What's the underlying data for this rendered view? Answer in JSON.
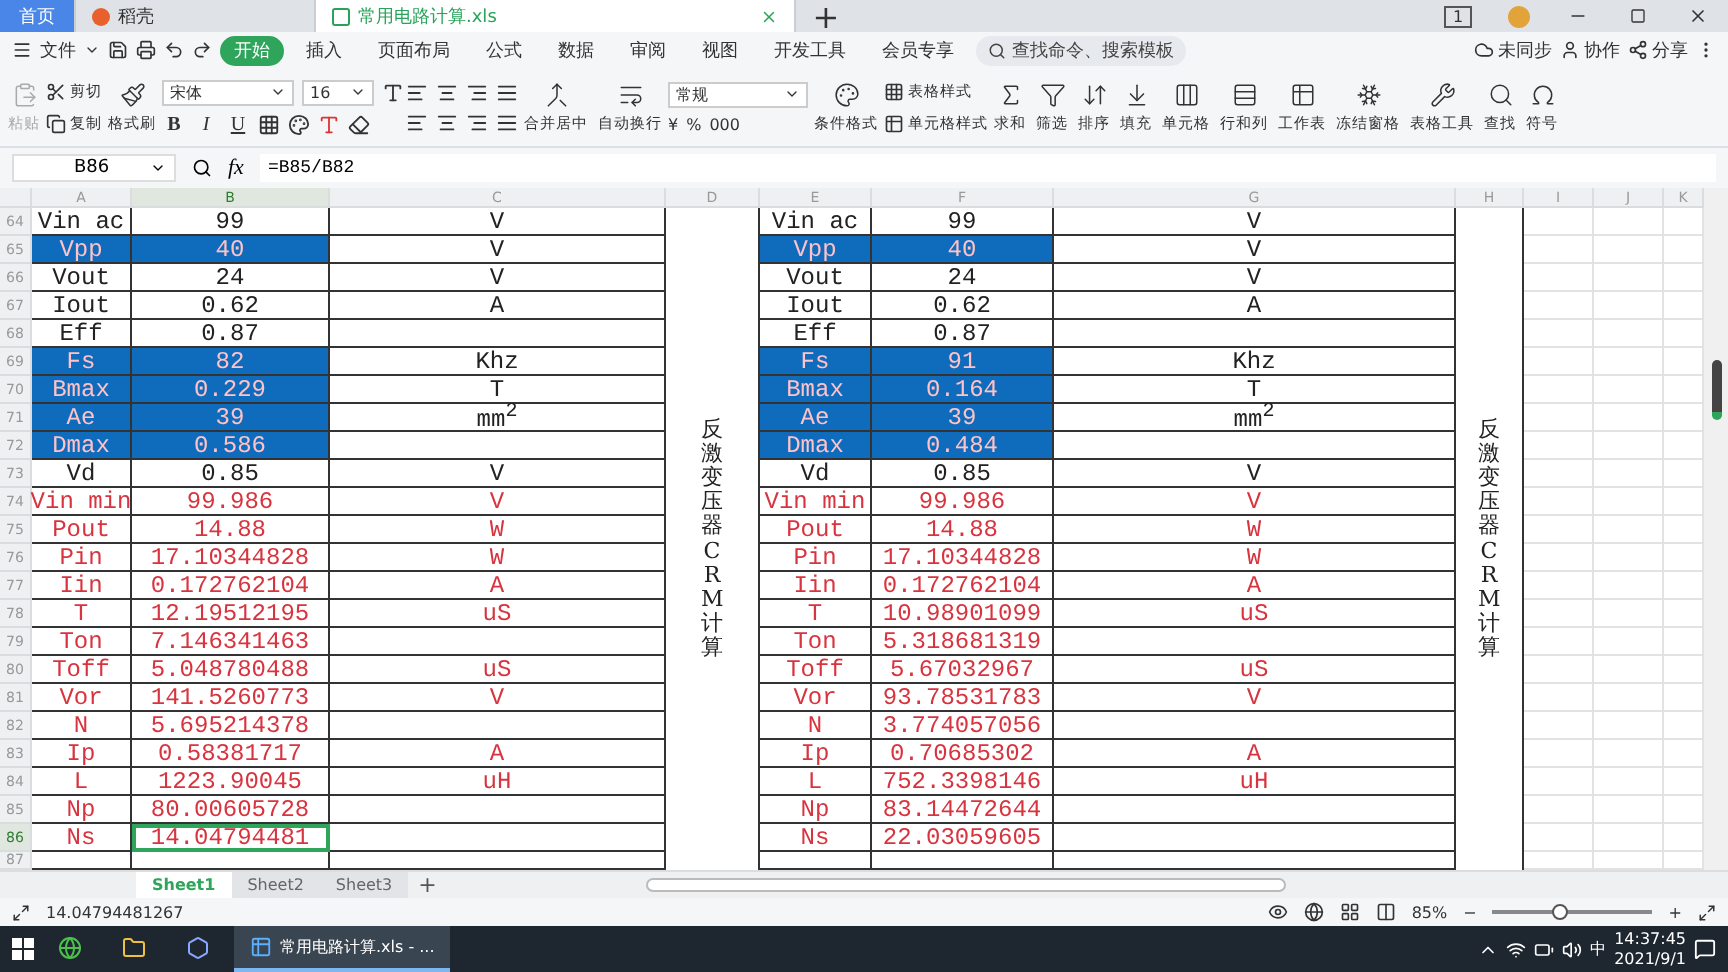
{
  "tabs": [
    {
      "label": "首页",
      "kind": "home",
      "selected": false
    },
    {
      "label": "稻壳",
      "kind": "docer",
      "selected": false
    },
    {
      "label": "常用电路计算.xls",
      "kind": "sheet",
      "selected": true
    }
  ],
  "new_tab": "+",
  "window_badge": "1",
  "menu": {
    "file": "文件",
    "items": [
      {
        "label": "开始",
        "selected": true
      },
      {
        "label": "插入",
        "selected": false
      },
      {
        "label": "页面布局",
        "selected": false
      },
      {
        "label": "公式",
        "selected": false
      },
      {
        "label": "数据",
        "selected": false
      },
      {
        "label": "审阅",
        "selected": false
      },
      {
        "label": "视图",
        "selected": false
      },
      {
        "label": "开发工具",
        "selected": false
      },
      {
        "label": "会员专享",
        "selected": false
      }
    ],
    "search": {
      "placeholder": "查找命令、搜索模板"
    },
    "right": [
      "未同步",
      "协作",
      "分享"
    ]
  },
  "ribbon": [
    {
      "kind": "big",
      "label": "粘贴",
      "disabled": true
    },
    {
      "kind": "stack",
      "items": [
        "剪切",
        "复制"
      ]
    },
    {
      "kind": "big",
      "label": "格式刷",
      "disabled": false
    },
    {
      "kind": "font",
      "font": "宋体",
      "size": "16",
      "styles": [
        "B",
        "I",
        "U"
      ]
    },
    {
      "kind": "align"
    },
    {
      "kind": "big",
      "label": "合并居中",
      "disabled": false
    },
    {
      "kind": "big",
      "label": "自动换行",
      "disabled": false
    },
    {
      "kind": "number",
      "format": "常规",
      "symbols": [
        "¥",
        "%",
        "000"
      ]
    },
    {
      "kind": "big",
      "label": "条件格式",
      "disabled": false
    },
    {
      "kind": "stack",
      "items": [
        "表格样式",
        "单元格样式"
      ]
    },
    {
      "kind": "big",
      "label": "求和",
      "disabled": false
    },
    {
      "kind": "big",
      "label": "筛选",
      "disabled": false
    },
    {
      "kind": "big",
      "label": "排序",
      "disabled": false
    },
    {
      "kind": "big",
      "label": "填充",
      "disabled": false
    },
    {
      "kind": "big",
      "label": "单元格",
      "disabled": false
    },
    {
      "kind": "big",
      "label": "行和列",
      "disabled": false
    },
    {
      "kind": "big",
      "label": "工作表",
      "disabled": false
    },
    {
      "kind": "big",
      "label": "冻结窗格",
      "disabled": false
    },
    {
      "kind": "big",
      "label": "表格工具",
      "disabled": false
    },
    {
      "kind": "big",
      "label": "查找",
      "disabled": false
    },
    {
      "kind": "big",
      "label": "符号",
      "disabled": false
    }
  ],
  "formula_bar": {
    "name_box": "B86",
    "fx": "fx",
    "formula": "=B85/B82"
  },
  "columns": [
    {
      "label": "A",
      "selected": false
    },
    {
      "label": "B",
      "selected": true
    },
    {
      "label": "C",
      "selected": false
    },
    {
      "label": "D",
      "selected": false
    },
    {
      "label": "E",
      "selected": false
    },
    {
      "label": "F",
      "selected": false
    },
    {
      "label": "G",
      "selected": false
    },
    {
      "label": "H",
      "selected": false
    },
    {
      "label": "I",
      "selected": false
    },
    {
      "label": "J",
      "selected": false
    },
    {
      "label": "K",
      "selected": false
    }
  ],
  "merged_note_left": "反激变压器CRM计算",
  "merged_note_right": "反激变压器CRM计算",
  "rows": [
    {
      "number": "64",
      "kind": "input",
      "selected": false,
      "left": {
        "label": "Vin ac",
        "value": "99",
        "unit": "V"
      },
      "right": {
        "label": "Vin ac",
        "value": "99",
        "unit": "V"
      }
    },
    {
      "number": "65",
      "kind": "highlight",
      "selected": false,
      "left": {
        "label": "Vpp",
        "value": "40",
        "unit": "V"
      },
      "right": {
        "label": "Vpp",
        "value": "40",
        "unit": "V"
      }
    },
    {
      "number": "66",
      "kind": "input",
      "selected": false,
      "left": {
        "label": "Vout",
        "value": "24",
        "unit": "V"
      },
      "right": {
        "label": "Vout",
        "value": "24",
        "unit": "V"
      }
    },
    {
      "number": "67",
      "kind": "input",
      "selected": false,
      "left": {
        "label": "Iout",
        "value": "0.62",
        "unit": "A"
      },
      "right": {
        "label": "Iout",
        "value": "0.62",
        "unit": "A"
      }
    },
    {
      "number": "68",
      "kind": "input",
      "selected": false,
      "left": {
        "label": "Eff",
        "value": "0.87"
      },
      "right": {
        "label": "Eff",
        "value": "0.87"
      }
    },
    {
      "number": "69",
      "kind": "highlight",
      "selected": false,
      "left": {
        "label": "Fs",
        "value": "82",
        "unit": "Khz"
      },
      "right": {
        "label": "Fs",
        "value": "91",
        "unit": "Khz"
      }
    },
    {
      "number": "70",
      "kind": "highlight",
      "selected": false,
      "left": {
        "label": "Bmax",
        "value": "0.229",
        "unit": "T"
      },
      "right": {
        "label": "Bmax",
        "value": "0.164",
        "unit": "T"
      }
    },
    {
      "number": "71",
      "kind": "highlight",
      "selected": false,
      "left": {
        "label": "Ae",
        "value": "39",
        "unit": "mm$^{2}$"
      },
      "right": {
        "label": "Ae",
        "value": "39",
        "unit": "mm$^{2}$"
      }
    },
    {
      "number": "72",
      "kind": "highlight",
      "selected": false,
      "left": {
        "label": "Dmax",
        "value": "0.586"
      },
      "right": {
        "label": "Dmax",
        "value": "0.484"
      }
    },
    {
      "number": "73",
      "kind": "input",
      "selected": false,
      "left": {
        "label": "Vd",
        "value": "0.85",
        "unit": "V"
      },
      "right": {
        "label": "Vd",
        "value": "0.85",
        "unit": "V"
      }
    },
    {
      "number": "74",
      "kind": "result",
      "selected": false,
      "left": {
        "label": "Vin min",
        "value": "99.986",
        "unit": "V"
      },
      "right": {
        "label": "Vin min",
        "value": "99.986",
        "unit": "V"
      }
    },
    {
      "number": "75",
      "kind": "result",
      "selected": false,
      "left": {
        "label": "Pout",
        "value": "14.88",
        "unit": "W"
      },
      "right": {
        "label": "Pout",
        "value": "14.88",
        "unit": "W"
      }
    },
    {
      "number": "76",
      "kind": "result",
      "selected": false,
      "left": {
        "label": "Pin",
        "value": "17.10344828",
        "unit": "W"
      },
      "right": {
        "label": "Pin",
        "value": "17.10344828",
        "unit": "W"
      }
    },
    {
      "number": "77",
      "kind": "result",
      "selected": false,
      "left": {
        "label": "Iin",
        "value": "0.172762104",
        "unit": "A"
      },
      "right": {
        "label": "Iin",
        "value": "0.172762104",
        "unit": "A"
      }
    },
    {
      "number": "78",
      "kind": "result",
      "selected": false,
      "left": {
        "label": "T",
        "value": "12.19512195",
        "unit": "uS"
      },
      "right": {
        "label": "T",
        "value": "10.98901099",
        "unit": "uS"
      }
    },
    {
      "number": "79",
      "kind": "result",
      "selected": false,
      "left": {
        "label": "Ton",
        "value": "7.146341463"
      },
      "right": {
        "label": "Ton",
        "value": "5.318681319"
      }
    },
    {
      "number": "80",
      "kind": "result",
      "selected": false,
      "left": {
        "label": "Toff",
        "value": "5.048780488",
        "unit": "uS"
      },
      "right": {
        "label": "Toff",
        "value": "5.67032967",
        "unit": "uS"
      }
    },
    {
      "number": "81",
      "kind": "result",
      "selected": false,
      "left": {
        "label": "Vor",
        "value": "141.5260773",
        "unit": "V"
      },
      "right": {
        "label": "Vor",
        "value": "93.78531783",
        "unit": "V"
      }
    },
    {
      "number": "82",
      "kind": "result",
      "selected": false,
      "left": {
        "label": "N",
        "value": "5.695214378"
      },
      "right": {
        "label": "N",
        "value": "3.774057056"
      }
    },
    {
      "number": "83",
      "kind": "result",
      "selected": false,
      "left": {
        "label": "Ip",
        "value": "0.58381717",
        "unit": "A"
      },
      "right": {
        "label": "Ip",
        "value": "0.70685302",
        "unit": "A"
      }
    },
    {
      "number": "84",
      "kind": "result",
      "selected": false,
      "left": {
        "label": "L",
        "value": "1223.90045",
        "unit": "uH"
      },
      "right": {
        "label": "L",
        "value": "752.3398146",
        "unit": "uH"
      }
    },
    {
      "number": "85",
      "kind": "result",
      "selected": false,
      "left": {
        "label": "Np",
        "value": "80.00605728"
      },
      "right": {
        "label": "Np",
        "value": "83.14472644"
      }
    },
    {
      "number": "86",
      "kind": "result",
      "selected": true,
      "left": {
        "label": "Ns",
        "value": "14.04794481"
      },
      "right": {
        "label": "Ns",
        "value": "22.03059605"
      }
    },
    {
      "number": "87",
      "kind": "blank",
      "selected": false
    }
  ],
  "sheet_tabs": [
    {
      "label": "Sheet1",
      "selected": true
    },
    {
      "label": "Sheet2",
      "selected": false
    },
    {
      "label": "Sheet3",
      "selected": false
    }
  ],
  "add_sheet": "+",
  "status_bar": {
    "value": "14.04794481267",
    "zoom": {
      "reading": "85%",
      "minus": "−",
      "plus": "+",
      "level": 0.42
    }
  },
  "taskbar": {
    "app": "常用电路计算.xls - ...",
    "ime": "中",
    "time": "14:37:45",
    "date": "2021/9/1"
  }
}
